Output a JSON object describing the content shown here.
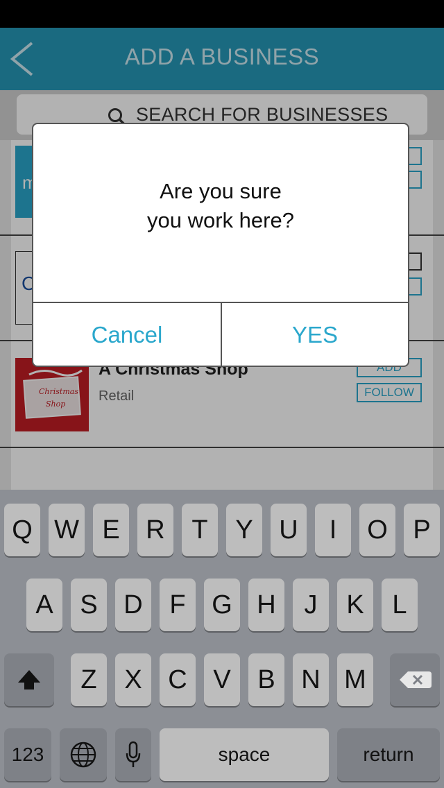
{
  "nav": {
    "title": "ADD A BUSINESS",
    "back_icon": "chevron-left-icon"
  },
  "search": {
    "placeholder": "SEARCH FOR BUSINESSES",
    "icon": "search-icon"
  },
  "list": {
    "items": [
      {
        "logo_text": "m"
      },
      {
        "logo_text": "C"
      },
      {
        "name": "A Christmas Shop",
        "category": "Retail",
        "add_label": "ADD",
        "follow_label": "FOLLOW"
      }
    ]
  },
  "dialog": {
    "line1": "Are you sure",
    "line2": "you work here?",
    "cancel_label": "Cancel",
    "yes_label": "YES"
  },
  "keyboard": {
    "row1": [
      "Q",
      "W",
      "E",
      "R",
      "T",
      "Y",
      "U",
      "I",
      "O",
      "P"
    ],
    "row2": [
      "A",
      "S",
      "D",
      "F",
      "G",
      "H",
      "J",
      "K",
      "L"
    ],
    "row3": [
      "Z",
      "X",
      "C",
      "V",
      "B",
      "N",
      "M"
    ],
    "numbers_label": "123",
    "space_label": "space",
    "return_label": "return"
  },
  "colors": {
    "accent": "#2aa7cc",
    "nav_bg": "#2699b8"
  }
}
